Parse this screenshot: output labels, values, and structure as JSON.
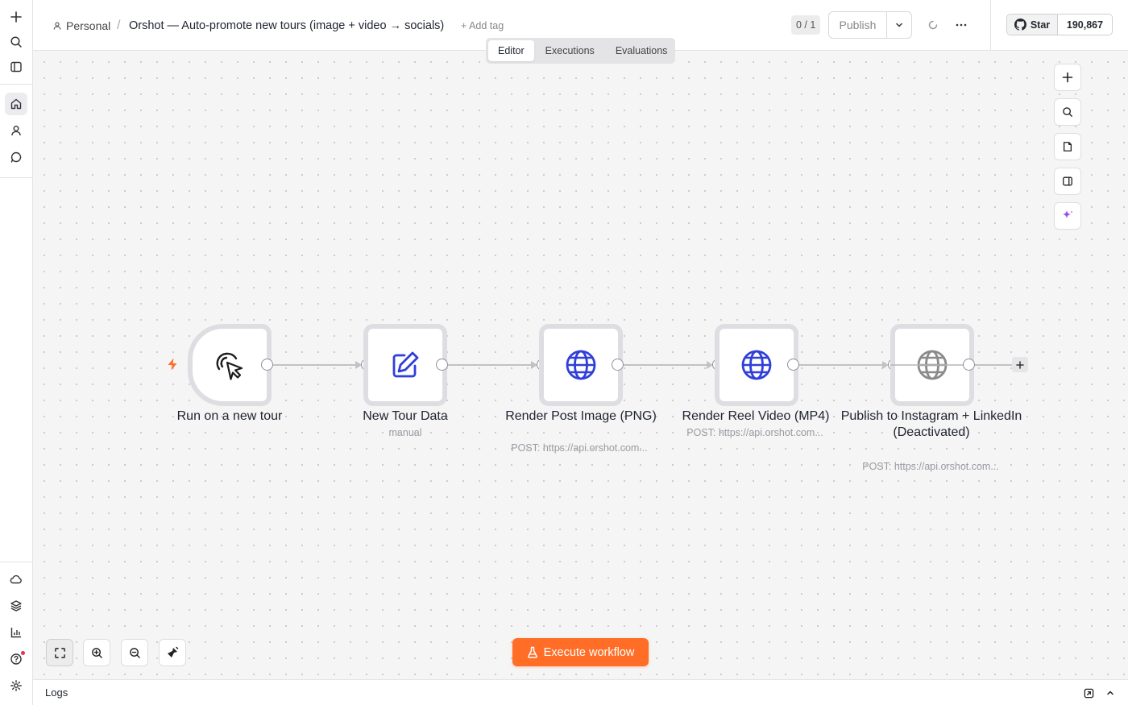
{
  "header": {
    "project": "Personal",
    "separator": "/",
    "workflow_name": "Orshot — Auto-promote new tours (image + video → socials)",
    "add_tag": "+ Add tag",
    "version": "0 / 1",
    "publish_label": "Publish",
    "github_star_label": "Star",
    "github_star_count": "190,867"
  },
  "tabs": [
    {
      "label": "Editor",
      "active": true
    },
    {
      "label": "Executions",
      "active": false
    },
    {
      "label": "Evaluations",
      "active": false
    }
  ],
  "nodes": [
    {
      "title": "Run on a new tour",
      "subtitle": "",
      "icon": "cursor-click-icon",
      "type": "trigger"
    },
    {
      "title": "New Tour Data",
      "subtitle": "manual",
      "icon": "pencil-square-icon",
      "type": "set"
    },
    {
      "title": "Render Post Image (PNG)",
      "subtitle": "POST: https://api.orshot.com...",
      "icon": "globe-icon",
      "type": "http"
    },
    {
      "title": "Render Reel Video (MP4)",
      "subtitle": "POST: https://api.orshot.com...",
      "icon": "globe-icon",
      "type": "http"
    },
    {
      "title": "Publish to Instagram + LinkedIn (Deactivated)",
      "subtitle": "POST: https://api.orshot.com...",
      "icon": "globe-icon",
      "type": "http",
      "deactivated": true
    }
  ],
  "execute_button": "Execute workflow",
  "logs_label": "Logs",
  "colors": {
    "accent": "#ff6d26",
    "node_icon": "#2f3fd8",
    "deactivated_icon": "#8a8a8a"
  }
}
